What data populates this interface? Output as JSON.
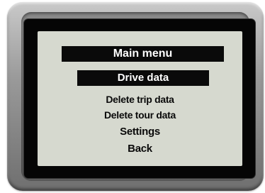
{
  "menu": {
    "title": "Main menu",
    "items": [
      {
        "label": "Drive data",
        "selected": true
      },
      {
        "label": "Delete trip data",
        "selected": false
      },
      {
        "label": "Delete tour data",
        "selected": false
      },
      {
        "label": "Settings",
        "selected": false
      },
      {
        "label": "Back",
        "selected": false
      }
    ]
  },
  "colors": {
    "lcd_background": "#d6d9cf",
    "highlight": "#0a0a0a",
    "highlight_text": "#ffffff",
    "text": "#0a0a0a",
    "bezel": "#9a9a9a"
  }
}
